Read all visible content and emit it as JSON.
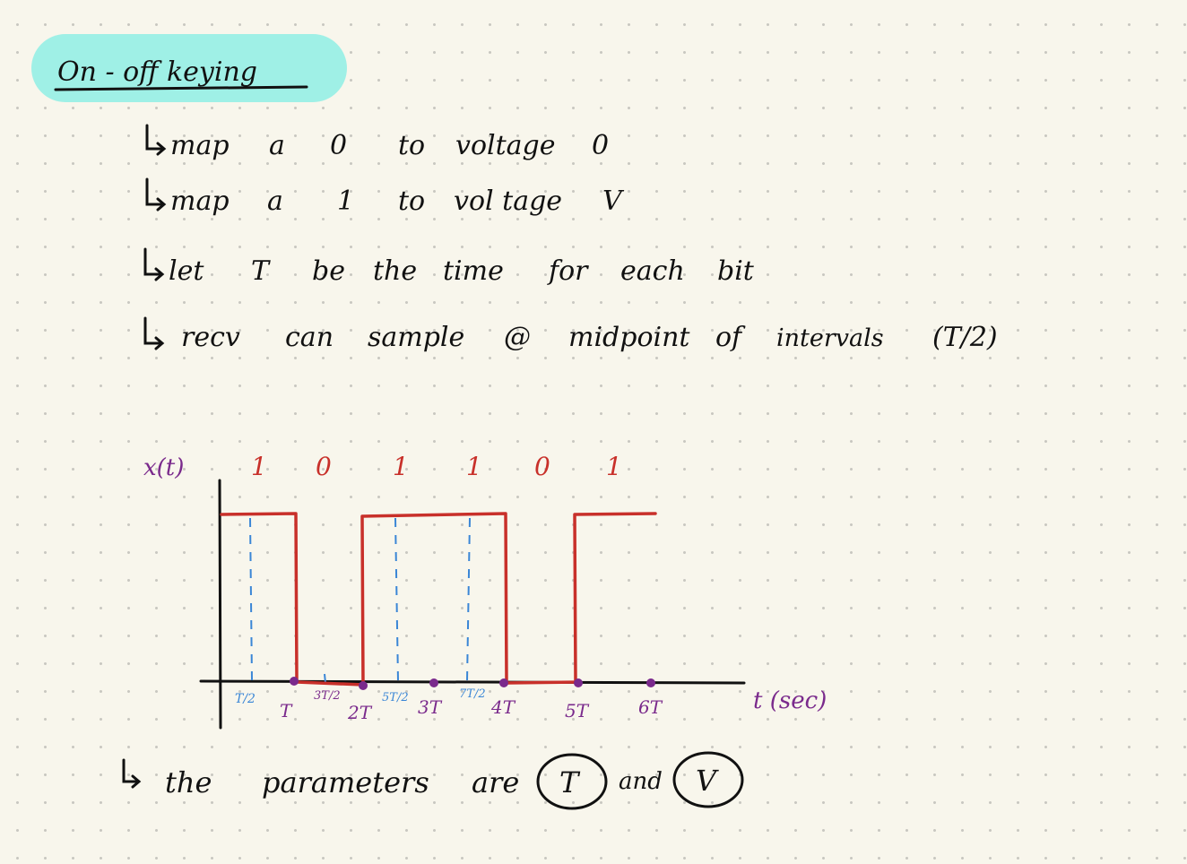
{
  "title": "On - off keying",
  "bullets": [
    [
      "map",
      "a",
      "0",
      "to",
      "voltage",
      "0"
    ],
    [
      "map",
      "a",
      "1",
      "to",
      "vol tage",
      "V"
    ],
    [
      "let",
      "T",
      "be",
      "the",
      "time",
      "for",
      "each",
      "bit"
    ],
    [
      "recv",
      "can",
      "sample",
      "@",
      "midpoint",
      "of",
      "intervals",
      "(T/2)"
    ]
  ],
  "figure": {
    "y_label": "x(t)",
    "x_label": "t (sec)",
    "bits": [
      "1",
      "0",
      "1",
      "1",
      "0",
      "1"
    ],
    "x_ticks": [
      "T",
      "2T",
      "3T",
      "4T",
      "5T",
      "6T"
    ],
    "sample_ticks": [
      "T/2",
      "3T/2",
      "5T/2",
      "7T/2"
    ]
  },
  "conclusion": {
    "prefix": "the",
    "word": "parameters",
    "verb": "are",
    "param1": "T",
    "joiner": "and",
    "param2": "V"
  },
  "colors": {
    "ink": "#111111",
    "highlight": "#9ff0e6",
    "signal": "#c8302a",
    "axis_purple": "#7a2a8c",
    "sample_blue": "#3a86d6"
  }
}
